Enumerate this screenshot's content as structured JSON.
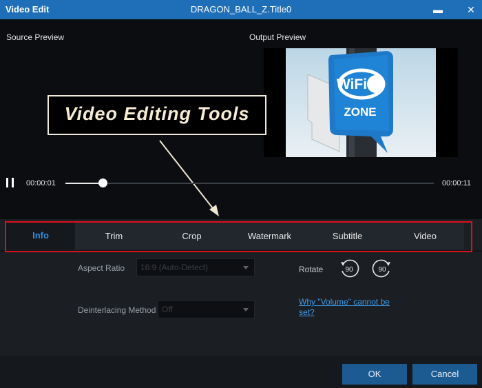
{
  "titlebar": {
    "app_title": "Video Edit",
    "file_title": "DRAGON_BALL_Z.Title0",
    "minimize_glyph": "▬",
    "close_glyph": "✕"
  },
  "preview": {
    "source_label": "Source Preview",
    "output_label": "Output Preview",
    "image_text": {
      "wifi": "WiFi",
      "zone": "ZONE"
    }
  },
  "callout": {
    "text": "Video Editing Tools"
  },
  "playback": {
    "current_time": "00:00:01",
    "total_time": "00:00:11",
    "progress": 0.1,
    "state_icon": "pause-icon"
  },
  "tabs": [
    {
      "label": "Info",
      "active": true
    },
    {
      "label": "Trim",
      "active": false
    },
    {
      "label": "Crop",
      "active": false
    },
    {
      "label": "Watermark",
      "active": false
    },
    {
      "label": "Subtitle",
      "active": false
    },
    {
      "label": "Video",
      "active": false
    }
  ],
  "info_pane": {
    "aspect_ratio_label": "Aspect Ratio",
    "aspect_ratio_value": "16:9 (Auto-Detect)",
    "deinterlacing_label": "Deinterlacing Method",
    "deinterlacing_value": "Off",
    "rotate_label": "Rotate",
    "rotate_left_value": "90",
    "rotate_right_value": "90",
    "volume_link": "Why \"Volume\" cannot be set?"
  },
  "footer": {
    "ok_label": "OK",
    "cancel_label": "Cancel"
  },
  "colors": {
    "titlebar": "#1f6fb8",
    "accent": "#2f8de0",
    "highlight_box": "#e0101b",
    "button": "#1c5b92"
  }
}
